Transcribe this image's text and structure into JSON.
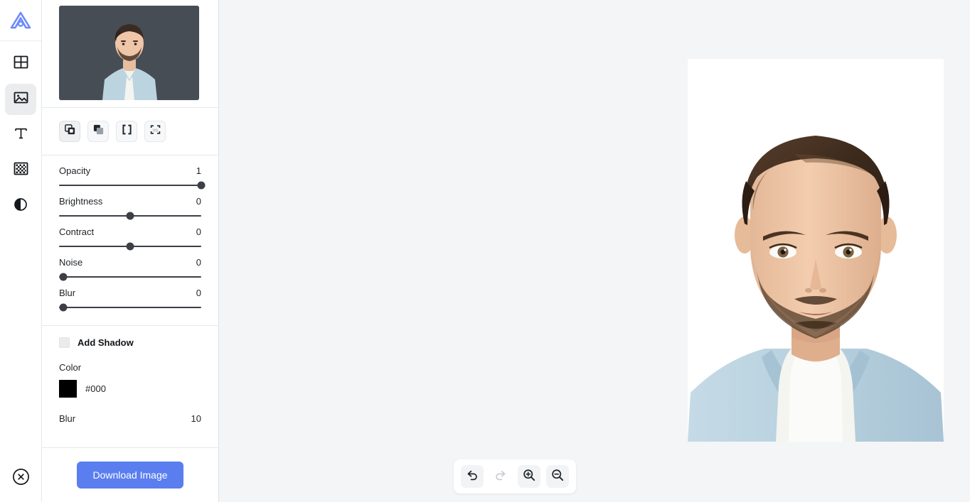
{
  "rail": {
    "logo_name": "app-logo",
    "items": [
      {
        "name": "templates",
        "icon": "grid-icon",
        "active": false
      },
      {
        "name": "image",
        "icon": "image-icon",
        "active": true
      },
      {
        "name": "text",
        "icon": "text-icon",
        "active": false
      },
      {
        "name": "background",
        "icon": "checkerboard-icon",
        "active": false
      },
      {
        "name": "adjust",
        "icon": "contrast-icon",
        "active": false
      }
    ],
    "close_icon": "close-circle-icon"
  },
  "panel": {
    "thumbnail_alt": "selected image thumbnail",
    "tools": [
      {
        "name": "duplicate",
        "icon": "duplicate-icon",
        "selected": true
      },
      {
        "name": "bring-forward",
        "icon": "bring-forward-icon",
        "selected": false
      },
      {
        "name": "group",
        "icon": "brackets-icon",
        "selected": false
      },
      {
        "name": "fit-frame",
        "icon": "fit-frame-icon",
        "selected": false
      }
    ],
    "sliders": [
      {
        "label": "Opacity",
        "value": "1",
        "pct": 100
      },
      {
        "label": "Brightness",
        "value": "0",
        "pct": 50
      },
      {
        "label": "Contract",
        "value": "0",
        "pct": 50
      },
      {
        "label": "Noise",
        "value": "0",
        "pct": 3
      },
      {
        "label": "Blur",
        "value": "0",
        "pct": 3
      }
    ],
    "shadow": {
      "checkbox_label": "Add Shadow",
      "checked": false,
      "color_label": "Color",
      "color_value": "#000",
      "blur_label": "Blur",
      "blur_value": "10"
    },
    "download_label": "Download Image"
  },
  "bottom_bar": {
    "buttons": [
      {
        "name": "undo",
        "icon": "undo-icon",
        "disabled": false
      },
      {
        "name": "redo",
        "icon": "redo-icon",
        "disabled": true
      },
      {
        "name": "zoom-in",
        "icon": "zoom-in-icon",
        "disabled": false
      },
      {
        "name": "zoom-out",
        "icon": "zoom-out-icon",
        "disabled": false
      }
    ]
  },
  "colors": {
    "accent": "#5a7ef0",
    "workspace_bg": "#f4f5f7",
    "panel_bg": "#ffffff",
    "slider": "#3c3f46",
    "shadow_color": "#000000"
  }
}
